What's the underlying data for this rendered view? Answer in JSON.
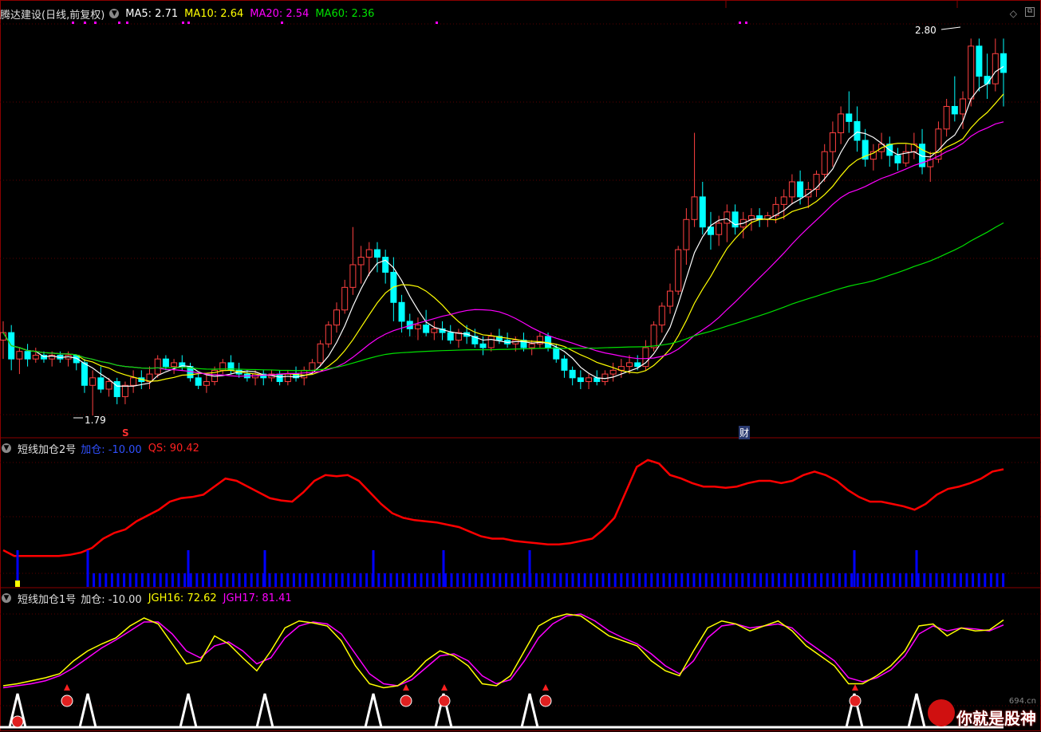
{
  "main_panel": {
    "stock_label": "腾达建设(日线,前复权)",
    "ma5": "MA5: 2.71",
    "ma10": "MA10: 2.64",
    "ma20": "MA20: 2.54",
    "ma60": "MA60: 2.36",
    "high_marker": "2.80",
    "low_marker": "1.79",
    "signal_s": "S",
    "signal_cai": "财"
  },
  "panel2": {
    "title": "短线加仓2号",
    "jc": "加仓: -10.00",
    "qs": "QS: 90.42"
  },
  "panel3": {
    "title": "短线加仓1号",
    "jc": "加仓: -10.00",
    "jgh16": "JGH16: 72.62",
    "jgh17": "JGH17: 81.41"
  },
  "watermark": {
    "text": "你就是股神",
    "site": "694.cn"
  },
  "colors": {
    "up": "#ff4040",
    "down": "#00ffff",
    "ma5": "#ffffff",
    "ma10": "#ffff00",
    "ma20": "#ff00ff",
    "ma60": "#00e000",
    "qs": "#ff0000",
    "jc": "#0000ff",
    "jgh16": "#ffff00",
    "jgh17": "#ff00ff"
  },
  "chart_data": [
    {
      "type": "candlestick",
      "title": "腾达建设(日线,前复权)",
      "price_markers": {
        "high": 2.8,
        "low": 1.79
      },
      "ohlc": [
        [
          2.0,
          2.05,
          1.95,
          2.02
        ],
        [
          2.02,
          2.04,
          1.92,
          1.95
        ],
        [
          1.95,
          1.98,
          1.91,
          1.97
        ],
        [
          1.97,
          1.99,
          1.93,
          1.95
        ],
        [
          1.95,
          1.98,
          1.94,
          1.96
        ],
        [
          1.96,
          1.97,
          1.94,
          1.95
        ],
        [
          1.95,
          1.97,
          1.93,
          1.96
        ],
        [
          1.96,
          1.97,
          1.94,
          1.95
        ],
        [
          1.95,
          1.97,
          1.93,
          1.96
        ],
        [
          1.96,
          1.96,
          1.92,
          1.94
        ],
        [
          1.94,
          1.95,
          1.86,
          1.88
        ],
        [
          1.88,
          1.92,
          1.8,
          1.9
        ],
        [
          1.9,
          1.93,
          1.86,
          1.87
        ],
        [
          1.87,
          1.9,
          1.85,
          1.89
        ],
        [
          1.89,
          1.9,
          1.83,
          1.85
        ],
        [
          1.85,
          1.89,
          1.83,
          1.88
        ],
        [
          1.88,
          1.92,
          1.86,
          1.9
        ],
        [
          1.9,
          1.92,
          1.87,
          1.89
        ],
        [
          1.89,
          1.93,
          1.87,
          1.91
        ],
        [
          1.91,
          1.96,
          1.9,
          1.95
        ],
        [
          1.95,
          1.96,
          1.92,
          1.93
        ],
        [
          1.93,
          1.95,
          1.91,
          1.94
        ],
        [
          1.94,
          1.96,
          1.92,
          1.93
        ],
        [
          1.93,
          1.94,
          1.89,
          1.9
        ],
        [
          1.9,
          1.91,
          1.87,
          1.88
        ],
        [
          1.88,
          1.91,
          1.86,
          1.89
        ],
        [
          1.89,
          1.93,
          1.88,
          1.92
        ],
        [
          1.92,
          1.95,
          1.91,
          1.94
        ],
        [
          1.94,
          1.96,
          1.91,
          1.92
        ],
        [
          1.92,
          1.94,
          1.9,
          1.91
        ],
        [
          1.91,
          1.92,
          1.89,
          1.9
        ],
        [
          1.9,
          1.92,
          1.88,
          1.91
        ],
        [
          1.91,
          1.92,
          1.88,
          1.9
        ],
        [
          1.9,
          1.92,
          1.89,
          1.91
        ],
        [
          1.91,
          1.92,
          1.88,
          1.89
        ],
        [
          1.89,
          1.92,
          1.88,
          1.91
        ],
        [
          1.91,
          1.93,
          1.89,
          1.9
        ],
        [
          1.9,
          1.93,
          1.88,
          1.92
        ],
        [
          1.92,
          1.95,
          1.91,
          1.94
        ],
        [
          1.94,
          2.0,
          1.93,
          1.99
        ],
        [
          1.99,
          2.05,
          1.98,
          2.04
        ],
        [
          2.04,
          2.1,
          2.02,
          2.08
        ],
        [
          2.08,
          2.16,
          2.07,
          2.14
        ],
        [
          2.14,
          2.3,
          2.12,
          2.2
        ],
        [
          2.2,
          2.25,
          2.15,
          2.22
        ],
        [
          2.22,
          2.26,
          2.17,
          2.24
        ],
        [
          2.24,
          2.26,
          2.18,
          2.22
        ],
        [
          2.22,
          2.24,
          2.15,
          2.18
        ],
        [
          2.18,
          2.22,
          2.05,
          2.1
        ],
        [
          2.1,
          2.12,
          2.02,
          2.05
        ],
        [
          2.05,
          2.07,
          2.01,
          2.03
        ],
        [
          2.03,
          2.06,
          2.0,
          2.04
        ],
        [
          2.04,
          2.08,
          2.01,
          2.02
        ],
        [
          2.02,
          2.05,
          2.0,
          2.03
        ],
        [
          2.03,
          2.05,
          2.0,
          2.02
        ],
        [
          2.02,
          2.04,
          1.99,
          2.0
        ],
        [
          2.0,
          2.03,
          1.98,
          2.02
        ],
        [
          2.02,
          2.04,
          1.99,
          2.01
        ],
        [
          2.01,
          2.03,
          1.98,
          1.99
        ],
        [
          1.99,
          2.01,
          1.96,
          1.98
        ],
        [
          1.98,
          2.02,
          1.97,
          2.01
        ],
        [
          2.01,
          2.03,
          1.99,
          2.0
        ],
        [
          2.0,
          2.02,
          1.98,
          1.99
        ],
        [
          1.99,
          2.01,
          1.97,
          2.0
        ],
        [
          2.0,
          2.02,
          1.97,
          1.98
        ],
        [
          1.98,
          2.0,
          1.96,
          1.99
        ],
        [
          1.99,
          2.02,
          1.98,
          2.01
        ],
        [
          2.01,
          2.02,
          1.97,
          1.98
        ],
        [
          1.98,
          1.99,
          1.94,
          1.95
        ],
        [
          1.95,
          1.96,
          1.9,
          1.92
        ],
        [
          1.92,
          1.93,
          1.88,
          1.9
        ],
        [
          1.9,
          1.92,
          1.87,
          1.89
        ],
        [
          1.89,
          1.91,
          1.87,
          1.9
        ],
        [
          1.9,
          1.92,
          1.88,
          1.89
        ],
        [
          1.89,
          1.92,
          1.88,
          1.91
        ],
        [
          1.91,
          1.94,
          1.89,
          1.92
        ],
        [
          1.92,
          1.95,
          1.9,
          1.93
        ],
        [
          1.93,
          1.96,
          1.91,
          1.94
        ],
        [
          1.94,
          1.96,
          1.92,
          1.93
        ],
        [
          1.93,
          2.0,
          1.92,
          1.98
        ],
        [
          1.98,
          2.05,
          1.97,
          2.04
        ],
        [
          2.04,
          2.1,
          2.02,
          2.09
        ],
        [
          2.09,
          2.15,
          2.07,
          2.13
        ],
        [
          2.13,
          2.25,
          2.12,
          2.24
        ],
        [
          2.24,
          2.35,
          2.2,
          2.32
        ],
        [
          2.32,
          2.55,
          2.3,
          2.38
        ],
        [
          2.38,
          2.42,
          2.28,
          2.3
        ],
        [
          2.3,
          2.34,
          2.24,
          2.28
        ],
        [
          2.28,
          2.33,
          2.25,
          2.31
        ],
        [
          2.31,
          2.36,
          2.26,
          2.34
        ],
        [
          2.34,
          2.36,
          2.28,
          2.3
        ],
        [
          2.3,
          2.34,
          2.27,
          2.32
        ],
        [
          2.32,
          2.35,
          2.29,
          2.33
        ],
        [
          2.33,
          2.35,
          2.3,
          2.32
        ],
        [
          2.32,
          2.34,
          2.3,
          2.33
        ],
        [
          2.33,
          2.38,
          2.31,
          2.36
        ],
        [
          2.36,
          2.4,
          2.32,
          2.38
        ],
        [
          2.38,
          2.44,
          2.36,
          2.42
        ],
        [
          2.42,
          2.45,
          2.36,
          2.38
        ],
        [
          2.38,
          2.42,
          2.35,
          2.4
        ],
        [
          2.4,
          2.45,
          2.38,
          2.44
        ],
        [
          2.44,
          2.52,
          2.42,
          2.5
        ],
        [
          2.5,
          2.58,
          2.46,
          2.55
        ],
        [
          2.55,
          2.62,
          2.52,
          2.6
        ],
        [
          2.6,
          2.66,
          2.55,
          2.58
        ],
        [
          2.58,
          2.62,
          2.5,
          2.53
        ],
        [
          2.53,
          2.56,
          2.46,
          2.48
        ],
        [
          2.48,
          2.52,
          2.45,
          2.5
        ],
        [
          2.5,
          2.55,
          2.48,
          2.52
        ],
        [
          2.52,
          2.54,
          2.46,
          2.49
        ],
        [
          2.49,
          2.51,
          2.45,
          2.47
        ],
        [
          2.47,
          2.52,
          2.46,
          2.5
        ],
        [
          2.5,
          2.55,
          2.48,
          2.52
        ],
        [
          2.52,
          2.56,
          2.44,
          2.46
        ],
        [
          2.46,
          2.5,
          2.42,
          2.48
        ],
        [
          2.48,
          2.58,
          2.47,
          2.56
        ],
        [
          2.56,
          2.64,
          2.54,
          2.62
        ],
        [
          2.62,
          2.7,
          2.58,
          2.6
        ],
        [
          2.6,
          2.66,
          2.56,
          2.64
        ],
        [
          2.64,
          2.8,
          2.62,
          2.78
        ],
        [
          2.78,
          2.8,
          2.66,
          2.7
        ],
        [
          2.7,
          2.76,
          2.64,
          2.68
        ],
        [
          2.68,
          2.8,
          2.66,
          2.76
        ],
        [
          2.76,
          2.8,
          2.62,
          2.71
        ]
      ]
    },
    {
      "type": "line",
      "title": "短线加仓2号",
      "y_range": [
        0,
        100
      ],
      "series": [
        {
          "name": "QS",
          "values": [
            20,
            15,
            15,
            15,
            15,
            15,
            16,
            18,
            22,
            30,
            35,
            38,
            45,
            50,
            55,
            62,
            65,
            66,
            68,
            75,
            82,
            80,
            75,
            70,
            65,
            63,
            62,
            70,
            80,
            85,
            84,
            85,
            80,
            70,
            60,
            52,
            48,
            46,
            45,
            44,
            42,
            40,
            36,
            32,
            30,
            30,
            28,
            27,
            26,
            25,
            25,
            26,
            28,
            30,
            38,
            48,
            70,
            92,
            98,
            95,
            85,
            82,
            78,
            75,
            75,
            74,
            75,
            78,
            80,
            80,
            78,
            80,
            85,
            88,
            85,
            80,
            72,
            66,
            62,
            62,
            60,
            58,
            55,
            60,
            68,
            73,
            75,
            78,
            82,
            88,
            90
          ]
        },
        {
          "name": "加仓",
          "values": [
            -10,
            -10,
            -10,
            -10,
            -10
          ]
        }
      ]
    },
    {
      "type": "line",
      "title": "短线加仓1号",
      "y_range": [
        0,
        100
      ],
      "series": [
        {
          "name": "JGH16",
          "values": [
            20,
            22,
            25,
            28,
            32,
            45,
            55,
            62,
            68,
            80,
            88,
            82,
            62,
            42,
            45,
            70,
            62,
            48,
            35,
            55,
            78,
            85,
            83,
            80,
            65,
            40,
            22,
            18,
            20,
            30,
            45,
            55,
            50,
            40,
            22,
            20,
            30,
            55,
            80,
            88,
            92,
            90,
            80,
            70,
            65,
            60,
            45,
            35,
            30,
            55,
            78,
            85,
            82,
            75,
            80,
            85,
            75,
            60,
            50,
            40,
            22,
            22,
            30,
            40,
            55,
            80,
            82,
            70,
            78,
            75,
            76,
            86
          ]
        },
        {
          "name": "JGH17",
          "values": [
            18,
            20,
            22,
            25,
            30,
            38,
            48,
            58,
            66,
            75,
            84,
            84,
            72,
            55,
            48,
            60,
            64,
            55,
            42,
            48,
            68,
            80,
            84,
            82,
            72,
            52,
            32,
            22,
            20,
            26,
            38,
            50,
            52,
            45,
            30,
            22,
            26,
            45,
            68,
            82,
            90,
            92,
            85,
            75,
            68,
            62,
            52,
            40,
            32,
            45,
            68,
            80,
            82,
            78,
            80,
            82,
            78,
            65,
            55,
            45,
            28,
            24,
            28,
            36,
            50,
            72,
            80,
            75,
            78,
            77,
            75,
            81
          ]
        }
      ]
    }
  ]
}
